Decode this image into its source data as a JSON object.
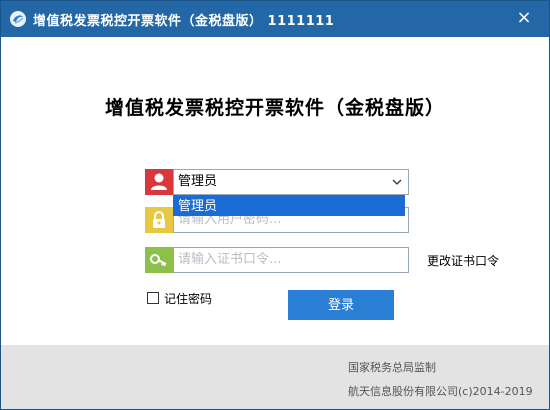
{
  "window": {
    "title": "增值税发票税控开票软件（金税盘版） 1111111",
    "close_label": "×"
  },
  "main": {
    "heading": "增值税发票税控开票软件（金税盘版）"
  },
  "user_field": {
    "value": "管理员",
    "icon": "user-icon"
  },
  "dropdown": {
    "options": [
      "管理员"
    ]
  },
  "password_field": {
    "placeholder": "请输入用户密码..."
  },
  "cert_field": {
    "placeholder": "请输入证书口令..."
  },
  "change_cert_password_label": "更改证书口令",
  "remember_password_label": "记住密码",
  "login_button_label": "登录",
  "footer": {
    "line1": "国家税务总局监制",
    "line2": "航天信息股份有限公司(c)2014-2019"
  },
  "colors": {
    "titlebar": "#2467a6",
    "user_icon_bg": "#d8383b",
    "lock_icon_bg": "#e8c842",
    "key_icon_bg": "#8cc04a",
    "login_button": "#2a7fd4",
    "dropdown_highlight": "#1a6bd3"
  }
}
